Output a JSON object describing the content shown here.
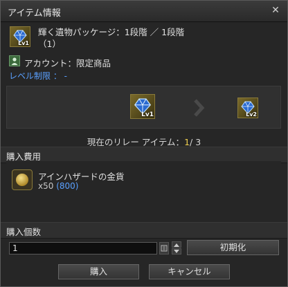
{
  "window": {
    "title": "アイテム情報",
    "close_symbol": "✕"
  },
  "item": {
    "name_line1": "輝く遺物パッケージ：1段階 ／ 1段階",
    "name_line2": "（1）",
    "level_badge": "Lv1"
  },
  "account": {
    "text": "アカウント：限定商品"
  },
  "level_limit": {
    "text": "レベル制限 ： -"
  },
  "relay": {
    "current_level_badge": "Lv1",
    "next_level_badge": "Lv2",
    "label": "現在のリレー アイテム：",
    "current": "1",
    "separator": "/ ",
    "total": "3"
  },
  "cost": {
    "section_label": "購入費用",
    "currency_name": "アインハザードの金貨",
    "quantity": "x50",
    "total": "(800)"
  },
  "purchase_qty": {
    "section_label": "購入個数",
    "value": "1",
    "reset_label": "初期化"
  },
  "buttons": {
    "buy": "購入",
    "cancel": "キャンセル"
  },
  "colors": {
    "accent_blue": "#5aa0ff",
    "highlight_yellow": "#f0d050",
    "frame_gold": "#8a7a3a"
  }
}
